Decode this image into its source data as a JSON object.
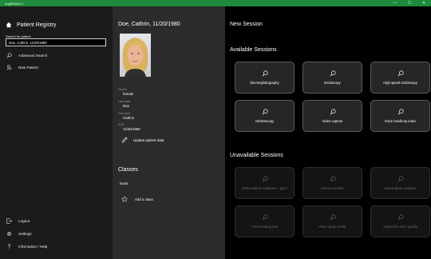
{
  "window": {
    "title": "ImgRNAV3.4",
    "minimize": "—",
    "maximize": "☐",
    "close": "✕"
  },
  "registry": {
    "title": "Patient Registry",
    "search_label": "Search for patient",
    "search_value": "Doe, Cathrin, 11/20/1980",
    "nav": [
      {
        "label": "Advanced Search",
        "icon": "search-icon"
      },
      {
        "label": "New Patient",
        "icon": "person-add-icon"
      }
    ],
    "bottom_nav": [
      {
        "label": "Logout",
        "icon": "logout-icon"
      },
      {
        "label": "Settings",
        "icon": "gear-icon"
      },
      {
        "label": "Information / Help",
        "icon": "help-icon"
      }
    ]
  },
  "patient": {
    "name": "Doe, Cathrin, 11/20/1980",
    "fields": [
      {
        "label": "Gender",
        "value": "female"
      },
      {
        "label": "Last name",
        "value": "Doe"
      },
      {
        "label": "First name",
        "value": "Cathrin"
      },
      {
        "label": "DOB",
        "value": "11/20/1980"
      }
    ],
    "update_label": "Update patient data",
    "classes_title": "Classes",
    "classes": [
      "tumor"
    ],
    "add_class_label": "Add a class"
  },
  "sessions": {
    "new_session_label": "New Session",
    "available_title": "Available Sessions",
    "available": [
      "Electroglottography",
      "Endoscopy",
      "High speed endoscopy",
      "Stroboscopy",
      "Video capture",
      "Voice handicap index"
    ],
    "unavailable_title": "Unavailable Sessions",
    "unavailable": [
      "Multi realtime loudness + pitch",
      "Sound recorder",
      "Spectrogram realtime",
      "Vocal loading test",
      "Voice range profile",
      "Vospector voice quality"
    ]
  }
}
